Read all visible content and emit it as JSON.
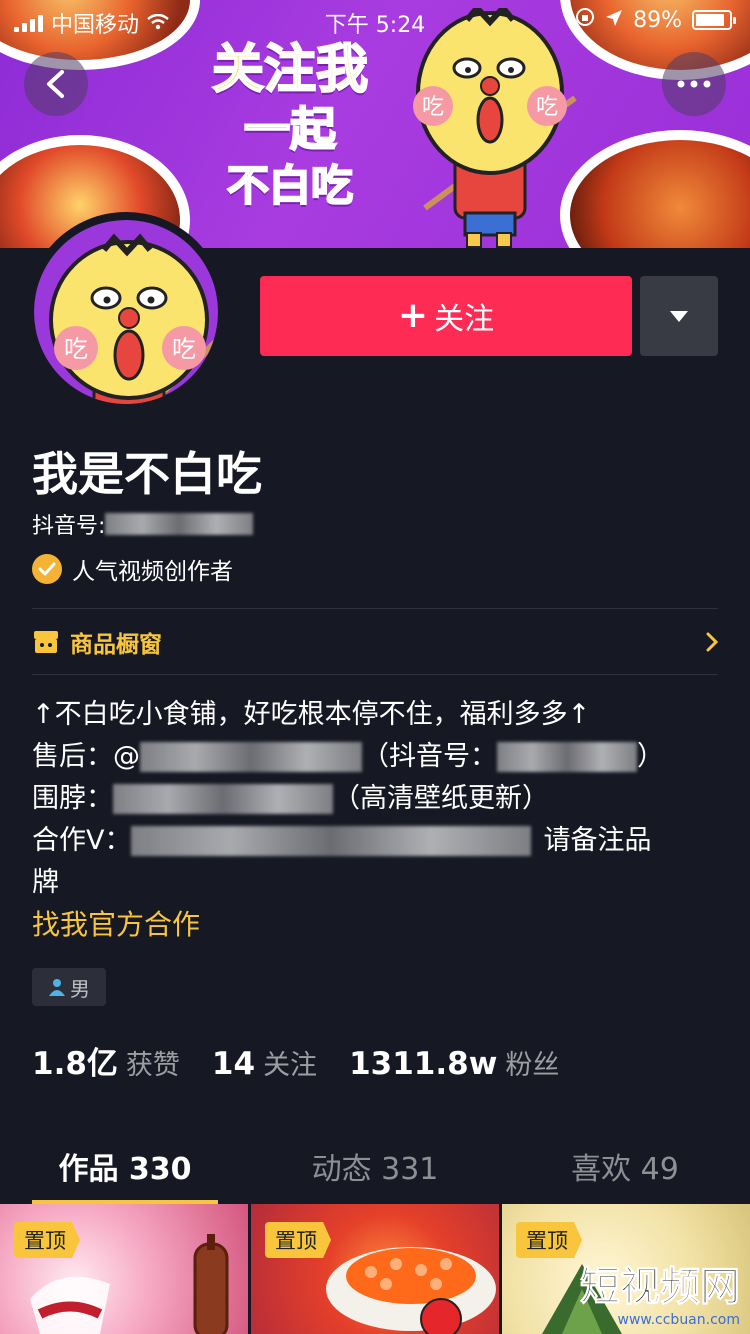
{
  "status_bar": {
    "carrier": "中国移动",
    "time": "下午 5:24",
    "battery": "89%",
    "battery_level": 0.89
  },
  "banner": {
    "line1": "关注我",
    "line2": "一起",
    "line3": "不白吃",
    "mascot_cheek_text": "吃"
  },
  "header": {
    "back_icon": "back-arrow-icon",
    "more_icon": "more-dots-icon"
  },
  "profile": {
    "follow_label": "关注",
    "follow_plus": "+",
    "nickname": "我是不白吃",
    "douyin_id_label": "抖音号:",
    "verify_label": "人气视频创作者",
    "shop_label": "商品橱窗",
    "gender": "男"
  },
  "bio": {
    "line1": "↑不白吃小食铺，好吃根本停不住，福利多多↑",
    "line2_prefix": "售后：@",
    "line2_mid": "（抖音号：",
    "line2_suffix": "）",
    "line3_prefix": "围脖：",
    "line3_suffix": "（高清壁纸更新）",
    "line4_prefix": "合作V：",
    "line4_suffix": "请备注品",
    "line5": "牌",
    "link": "找我官方合作"
  },
  "stats": [
    {
      "num": "1.8亿",
      "label": "获赞"
    },
    {
      "num": "14",
      "label": "关注"
    },
    {
      "num": "1311.8w",
      "label": "粉丝"
    }
  ],
  "tabs": [
    {
      "label": "作品 330",
      "active": true
    },
    {
      "label": "动态 331",
      "active": false
    },
    {
      "label": "喜欢 49",
      "active": false
    }
  ],
  "grid": {
    "pin_label": "置顶",
    "watermark_big": "短视频网",
    "watermark_small": "www.ccbuan.com"
  },
  "colors": {
    "background": "#161823",
    "follow": "#fe2c55",
    "accent": "#f8c53c",
    "banner": "#9a2fd8"
  }
}
